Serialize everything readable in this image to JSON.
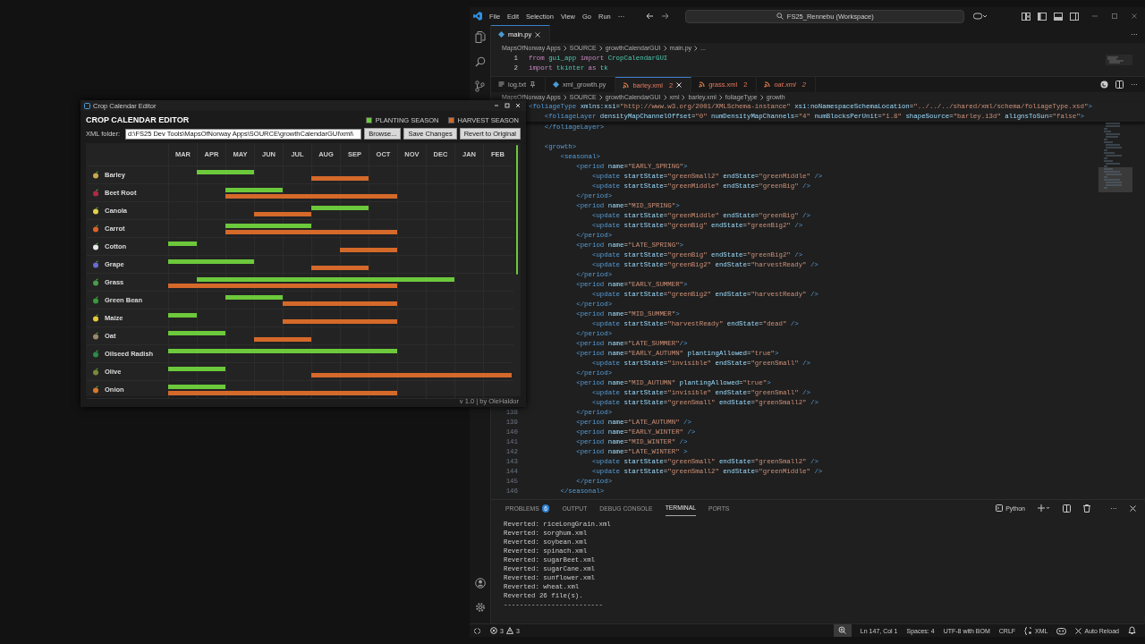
{
  "crop_editor": {
    "window_title": "Crop Calendar Editor",
    "heading": "CROP CALENDAR EDITOR",
    "legend": [
      {
        "label": "PLANTING SEASON",
        "color": "#6cc93b"
      },
      {
        "label": "HARVEST SEASON",
        "color": "#d5692a"
      }
    ],
    "folder_label": "XML folder:",
    "folder_value": "d:\\FS25 Dev Tools\\MapsOfNorway Apps\\SOURCE\\growthCalendarGUI\\xml\\",
    "buttons": [
      "Browse...",
      "Save Changes",
      "Revert to Original"
    ],
    "months": [
      "MAR",
      "APR",
      "MAY",
      "JUN",
      "JUL",
      "AUG",
      "SEP",
      "OCT",
      "NOV",
      "DEC",
      "JAN",
      "FEB"
    ],
    "crops": [
      {
        "name": "Barley",
        "planting": [
          false,
          true,
          true,
          false,
          false,
          false,
          false,
          false,
          false,
          false,
          false,
          false
        ],
        "harvest": [
          false,
          false,
          false,
          false,
          false,
          true,
          true,
          false,
          false,
          false,
          false,
          false
        ]
      },
      {
        "name": "Beet Root",
        "planting": [
          false,
          false,
          true,
          true,
          false,
          false,
          false,
          false,
          false,
          false,
          false,
          false
        ],
        "harvest": [
          false,
          false,
          true,
          true,
          true,
          true,
          true,
          true,
          false,
          false,
          false,
          false
        ]
      },
      {
        "name": "Canola",
        "planting": [
          false,
          false,
          false,
          false,
          false,
          true,
          true,
          false,
          false,
          false,
          false,
          false
        ],
        "harvest": [
          false,
          false,
          false,
          true,
          true,
          false,
          false,
          false,
          false,
          false,
          false,
          false
        ]
      },
      {
        "name": "Carrot",
        "planting": [
          false,
          false,
          true,
          true,
          true,
          false,
          false,
          false,
          false,
          false,
          false,
          false
        ],
        "harvest": [
          false,
          false,
          true,
          true,
          true,
          true,
          true,
          true,
          false,
          false,
          false,
          false
        ]
      },
      {
        "name": "Cotton",
        "planting": [
          true,
          false,
          false,
          false,
          false,
          false,
          false,
          false,
          false,
          false,
          false,
          false
        ],
        "harvest": [
          false,
          false,
          false,
          false,
          false,
          false,
          true,
          true,
          false,
          false,
          false,
          false
        ]
      },
      {
        "name": "Grape",
        "planting": [
          true,
          true,
          true,
          false,
          false,
          false,
          false,
          false,
          false,
          false,
          false,
          false
        ],
        "harvest": [
          false,
          false,
          false,
          false,
          false,
          true,
          true,
          false,
          false,
          false,
          false,
          false
        ]
      },
      {
        "name": "Grass",
        "planting": [
          false,
          true,
          true,
          true,
          true,
          true,
          true,
          true,
          true,
          true,
          false,
          false
        ],
        "harvest": [
          true,
          true,
          true,
          true,
          true,
          true,
          true,
          true,
          false,
          false,
          false,
          false
        ]
      },
      {
        "name": "Green Bean",
        "planting": [
          false,
          false,
          true,
          true,
          false,
          false,
          false,
          false,
          false,
          false,
          false,
          false
        ],
        "harvest": [
          false,
          false,
          false,
          false,
          true,
          true,
          true,
          true,
          false,
          false,
          false,
          false
        ]
      },
      {
        "name": "Maize",
        "planting": [
          true,
          false,
          false,
          false,
          false,
          false,
          false,
          false,
          false,
          false,
          false,
          false
        ],
        "harvest": [
          false,
          false,
          false,
          false,
          true,
          true,
          true,
          true,
          false,
          false,
          false,
          false
        ]
      },
      {
        "name": "Oat",
        "planting": [
          true,
          true,
          false,
          false,
          false,
          false,
          false,
          false,
          false,
          false,
          false,
          false
        ],
        "harvest": [
          false,
          false,
          false,
          true,
          true,
          false,
          false,
          false,
          false,
          false,
          false,
          false
        ]
      },
      {
        "name": "Oilseed Radish",
        "planting": [
          true,
          true,
          true,
          true,
          true,
          true,
          true,
          true,
          false,
          false,
          false,
          false
        ],
        "harvest": [
          false,
          false,
          false,
          false,
          false,
          false,
          false,
          false,
          false,
          false,
          false,
          false
        ]
      },
      {
        "name": "Olive",
        "planting": [
          true,
          true,
          false,
          false,
          false,
          false,
          false,
          false,
          false,
          false,
          false,
          false
        ],
        "harvest": [
          false,
          false,
          false,
          false,
          false,
          true,
          true,
          true,
          true,
          true,
          true,
          true
        ]
      },
      {
        "name": "Onion",
        "planting": [
          true,
          true,
          false,
          false,
          false,
          false,
          false,
          false,
          false,
          false,
          false,
          false
        ],
        "harvest": [
          true,
          true,
          true,
          true,
          true,
          true,
          true,
          true,
          false,
          false,
          false,
          false
        ]
      }
    ],
    "footer": "v 1.0 | by OleHaldor"
  },
  "vscode": {
    "menu": [
      "File",
      "Edit",
      "Selection",
      "View",
      "Go",
      "Run",
      "···"
    ],
    "search": "FS25_Rennebu (Workspace)",
    "top_editor": {
      "tabs": [
        {
          "label": "main.py",
          "kind": "python",
          "selected": true
        }
      ],
      "more": "···",
      "breadcrumb": [
        "MapsOfNorway Apps",
        "SOURCE",
        "growthCalendarGUI",
        "main.py",
        "..."
      ],
      "lines": [
        {
          "number": "1",
          "text": "from gui_app import CropCalendarGUI"
        },
        {
          "number": "2",
          "text": "import tkinter as tk"
        }
      ]
    },
    "bottom_editor": {
      "more": "···",
      "tabs": [
        {
          "label": "log.txt",
          "kind": "text",
          "preview": false,
          "selected": false
        },
        {
          "label": "xml_growth.py",
          "kind": "python",
          "preview": false,
          "selected": false
        },
        {
          "label": "barley.xml",
          "kind": "xml",
          "problems": "2",
          "preview": false,
          "selected": true
        },
        {
          "label": "grass.xml",
          "kind": "xml",
          "problems": "2",
          "preview": false,
          "selected": false
        },
        {
          "label": "oat.xml",
          "kind": "xml",
          "problems": "2",
          "preview": true,
          "selected": false
        }
      ],
      "breadcrumb": [
        "MapsOfNorway Apps",
        "SOURCE",
        "growthCalendarGUI",
        "xml",
        "barley.xml",
        "foliageType",
        "growth"
      ],
      "sticky_lines": [
        {
          "text": "<foliageType xmlns:xsi=\"http://www.w3.org/2001/XMLSchema-instance\" xsi:noNamespaceSchemaLocation=\"../../../shared/xml/schema/foliageType.xsd\">"
        },
        {
          "text": "    <foliageLayer densityMapChannelOffset=\"0\" numDensityMapChannels=\"4\" numBlocksPerUnit=\"1.8\" shapeSource=\"barley.i3d\" alignsToSun=\"false\">"
        }
      ],
      "lines": [
        {
          "text": "    </foliageLayer>"
        },
        {
          "text": "    <growth>",
          "blank_before": true
        },
        {
          "text": "        <seasonal>"
        },
        {
          "text": "            <period name=\"EARLY_SPRING\">"
        },
        {
          "text": "                <update startState=\"greenSmall2\" endState=\"greenMiddle\" />"
        },
        {
          "text": "                <update startState=\"greenMiddle\" endState=\"greenBig\" />"
        },
        {
          "text": "            </period>"
        },
        {
          "text": "            <period name=\"MID_SPRING\">"
        },
        {
          "text": "                <update startState=\"greenMiddle\" endState=\"greenBig\" />"
        },
        {
          "text": "                <update startState=\"greenBig\" endState=\"greenBig2\" />"
        },
        {
          "text": "            </period>"
        },
        {
          "text": "            <period name=\"LATE_SPRING\">"
        },
        {
          "text": "                <update startState=\"greenBig\" endState=\"greenBig2\" />"
        },
        {
          "text": "                <update startState=\"greenBig2\" endState=\"harvestReady\" />"
        },
        {
          "text": "            </period>"
        },
        {
          "text": "            <period name=\"EARLY_SUMMER\">"
        },
        {
          "text": "                <update startState=\"greenBig2\" endState=\"harvestReady\" />"
        },
        {
          "text": "            </period>"
        },
        {
          "text": "            <period name=\"MID_SUMMER\">"
        },
        {
          "text": "                <update startState=\"harvestReady\" endState=\"dead\" />"
        },
        {
          "text": "            </period>"
        },
        {
          "text": "            <period name=\"LATE_SUMMER\"/>"
        },
        {
          "text": "            <period name=\"EARLY_AUTUMN\" plantingAllowed=\"true\">"
        },
        {
          "text": "                <update startState=\"invisible\" endState=\"greenSmall\" />"
        },
        {
          "text": "            </period>"
        },
        {
          "text": "            <period name=\"MID_AUTUMN\" plantingAllowed=\"true\">"
        },
        {
          "text": "                <update startState=\"invisible\" endState=\"greenSmall\" />"
        },
        {
          "text": "                <update startState=\"greenSmall\" endState=\"greenSmall2\" />"
        },
        {
          "number": "138",
          "text": "            </period>"
        },
        {
          "number": "139",
          "text": "            <period name=\"LATE_AUTUMN\" />"
        },
        {
          "number": "140",
          "text": "            <period name=\"EARLY_WINTER\" />"
        },
        {
          "number": "141",
          "text": "            <period name=\"MID_WINTER\" />"
        },
        {
          "number": "142",
          "text": "            <period name=\"LATE_WINTER\" >"
        },
        {
          "number": "143",
          "text": "                <update startState=\"greenSmall\" endState=\"greenSmall2\" />"
        },
        {
          "number": "144",
          "text": "                <update startState=\"greenSmall2\" endState=\"greenMiddle\" />"
        },
        {
          "number": "145",
          "text": "            </period>"
        },
        {
          "number": "146",
          "text": "        </seasonal>"
        }
      ]
    },
    "panel": {
      "tabs": [
        {
          "label": "PROBLEMS",
          "badge": "6",
          "selected": false
        },
        {
          "label": "OUTPUT",
          "selected": false
        },
        {
          "label": "DEBUG CONSOLE",
          "selected": false
        },
        {
          "label": "TERMINAL",
          "selected": true
        },
        {
          "label": "PORTS",
          "selected": false
        }
      ],
      "terminal_name": "Python",
      "more": "···",
      "output": [
        "Reverted: riceLongGrain.xml",
        "Reverted: sorghum.xml",
        "Reverted: soybean.xml",
        "Reverted: spinach.xml",
        "Reverted: sugarBeet.xml",
        "Reverted: sugarCane.xml",
        "Reverted: sunflower.xml",
        "Reverted: wheat.xml",
        "Reverted 26 file(s).",
        "-------------------------"
      ]
    },
    "status": {
      "errors": "3",
      "warnings": "3",
      "items": [
        "Ln 147, Col 1",
        "Spaces: 4",
        "UTF-8 with BOM",
        "CRLF"
      ],
      "language": "XML",
      "auto_reload": "Auto Reload"
    }
  }
}
